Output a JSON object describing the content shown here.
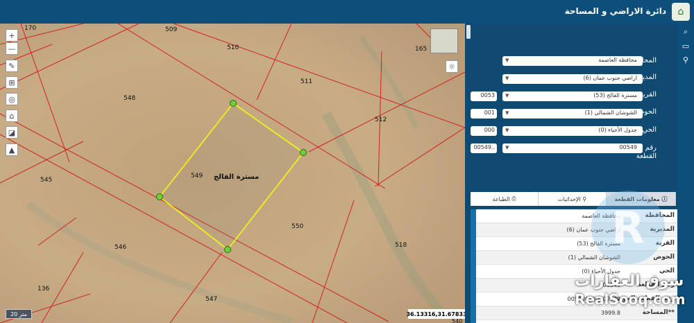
{
  "header": {
    "title": "دائرة الاراضي و المساحة",
    "logo_icon": "dls-logo-icon"
  },
  "map": {
    "parcel_labels": [
      "170",
      "509",
      "510",
      "165",
      "511",
      "548",
      "512",
      "545",
      "549",
      "550",
      "546",
      "518",
      "136",
      "547",
      "540"
    ],
    "parcel_name": "مسترة الفالج",
    "scale_label": "20 متر",
    "coordinates": "36.13316,31.67833",
    "tools": [
      "zoom-in-icon",
      "zoom-out-icon",
      "pencil-icon",
      "ruler-icon",
      "locate-icon",
      "home-icon",
      "chart-icon",
      "compass-icon"
    ],
    "zoom_in": "+",
    "zoom_out": "—"
  },
  "form": {
    "governorate": {
      "label": "المحافظة",
      "value": "محافظة العاصمة"
    },
    "directorate": {
      "label": "المديرية",
      "value": "اراضي جنوب عمان (6)"
    },
    "village": {
      "label": "القرية",
      "value": "مسترة الفالج (53)",
      "code": "0053"
    },
    "basin": {
      "label": "الحوض",
      "value": "الشوشان الشمالي (1)",
      "code": "001"
    },
    "neighborhood": {
      "label": "الحي",
      "value": "جدول الأحياء (0)",
      "code": "000"
    },
    "parcel": {
      "label": "رقم القطعة",
      "value": "00549",
      "code": "00549.."
    }
  },
  "tabs": [
    {
      "label": "معلومات القطعة",
      "icon": "info-icon",
      "active": true
    },
    {
      "label": "الإحداثيات",
      "icon": "pin-icon",
      "active": false
    },
    {
      "label": "الطباعة",
      "icon": "print-icon",
      "active": false
    }
  ],
  "info_rows": [
    {
      "key": "المحافظة",
      "value": "محافظة العاصمة"
    },
    {
      "key": "المديرية",
      "value": "اراضي جنوب عمان (6)"
    },
    {
      "key": "القرية",
      "value": "مسترة الفالج (53)"
    },
    {
      "key": "الحوض",
      "value": "الشوشان الشمالي (1)"
    },
    {
      "key": "الحي",
      "value": "جدول الأحياء (0)"
    },
    {
      "key": "رقم القطعة",
      "value": "00549"
    },
    {
      "key": "رقم القطعة الموحد",
      "value": "005300100000549"
    },
    {
      "key": "**المساحة",
      "value": "3999.8"
    }
  ],
  "watermark": {
    "arabic": "سوق العقارات",
    "latin": "RealSooq.com",
    "letter": "R"
  }
}
